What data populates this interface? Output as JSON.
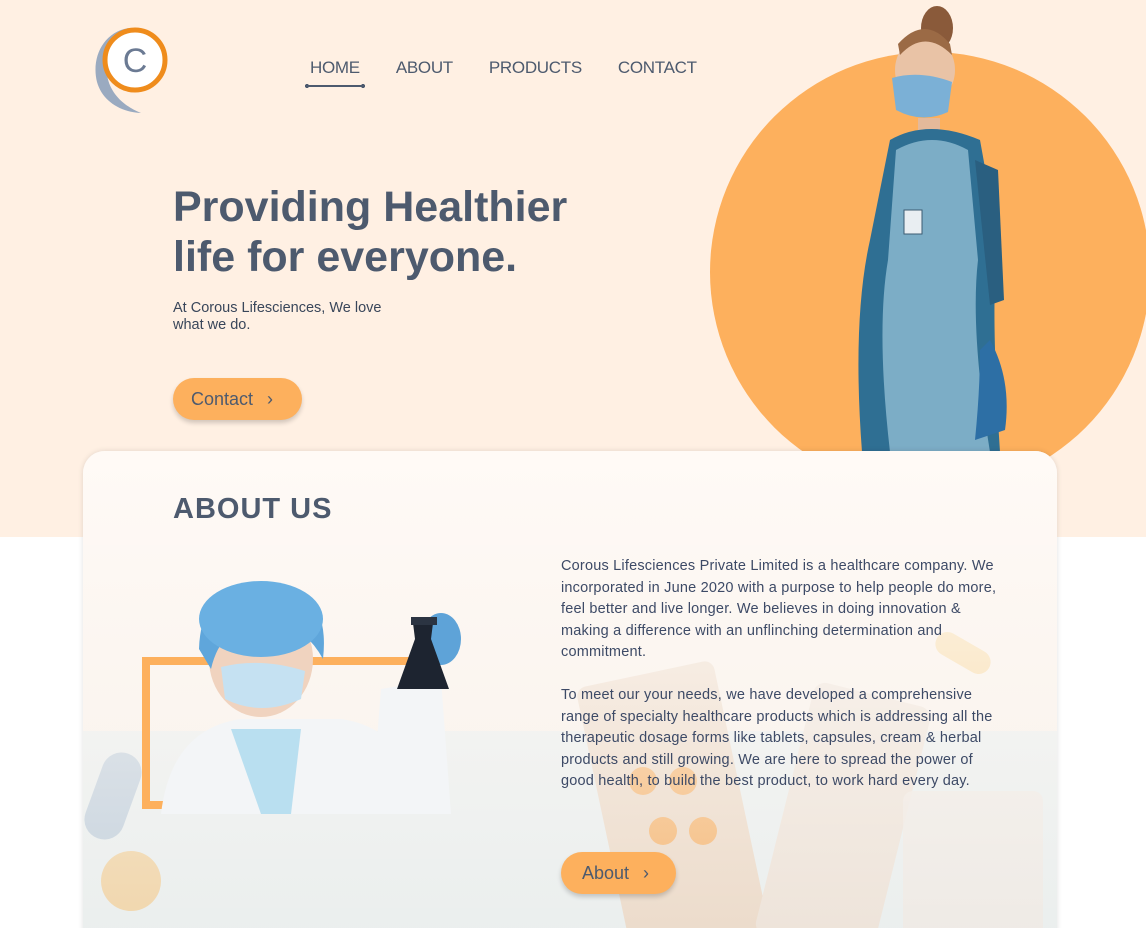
{
  "brand": {
    "logo_letter": "C",
    "colors": {
      "orange": "#fdb05d",
      "slate": "#4d5a6e",
      "cream": "#fff0e3"
    }
  },
  "nav": {
    "items": [
      {
        "label": "HOME",
        "active": true
      },
      {
        "label": "ABOUT",
        "active": false
      },
      {
        "label": "PRODUCTS",
        "active": false
      },
      {
        "label": "CONTACT",
        "active": false
      }
    ]
  },
  "hero": {
    "headline_line1": "Providing Healthier",
    "headline_line2": "life for everyone.",
    "tagline": "At Corous Lifesciences, We love what we do.",
    "cta_label": "Contact",
    "cta_icon": "chevron-right-icon"
  },
  "about": {
    "title": "ABOUT US",
    "paragraph1": "Corous Lifesciences Private Limited  is a healthcare company. We incorporated in June 2020 with a purpose to help people do more, feel better and live longer. We believes in doing innovation & making a difference with an unflinching determination and commitment.",
    "paragraph2": "To meet our your needs, we have developed a comprehensive range of specialty healthcare products which is addressing all the therapeutic dosage forms like tablets, capsules, cream & herbal products and still growing. We are here to spread the power of good health, to build the best product, to work hard every day.",
    "cta_label": "About",
    "cta_icon": "chevron-right-icon"
  }
}
